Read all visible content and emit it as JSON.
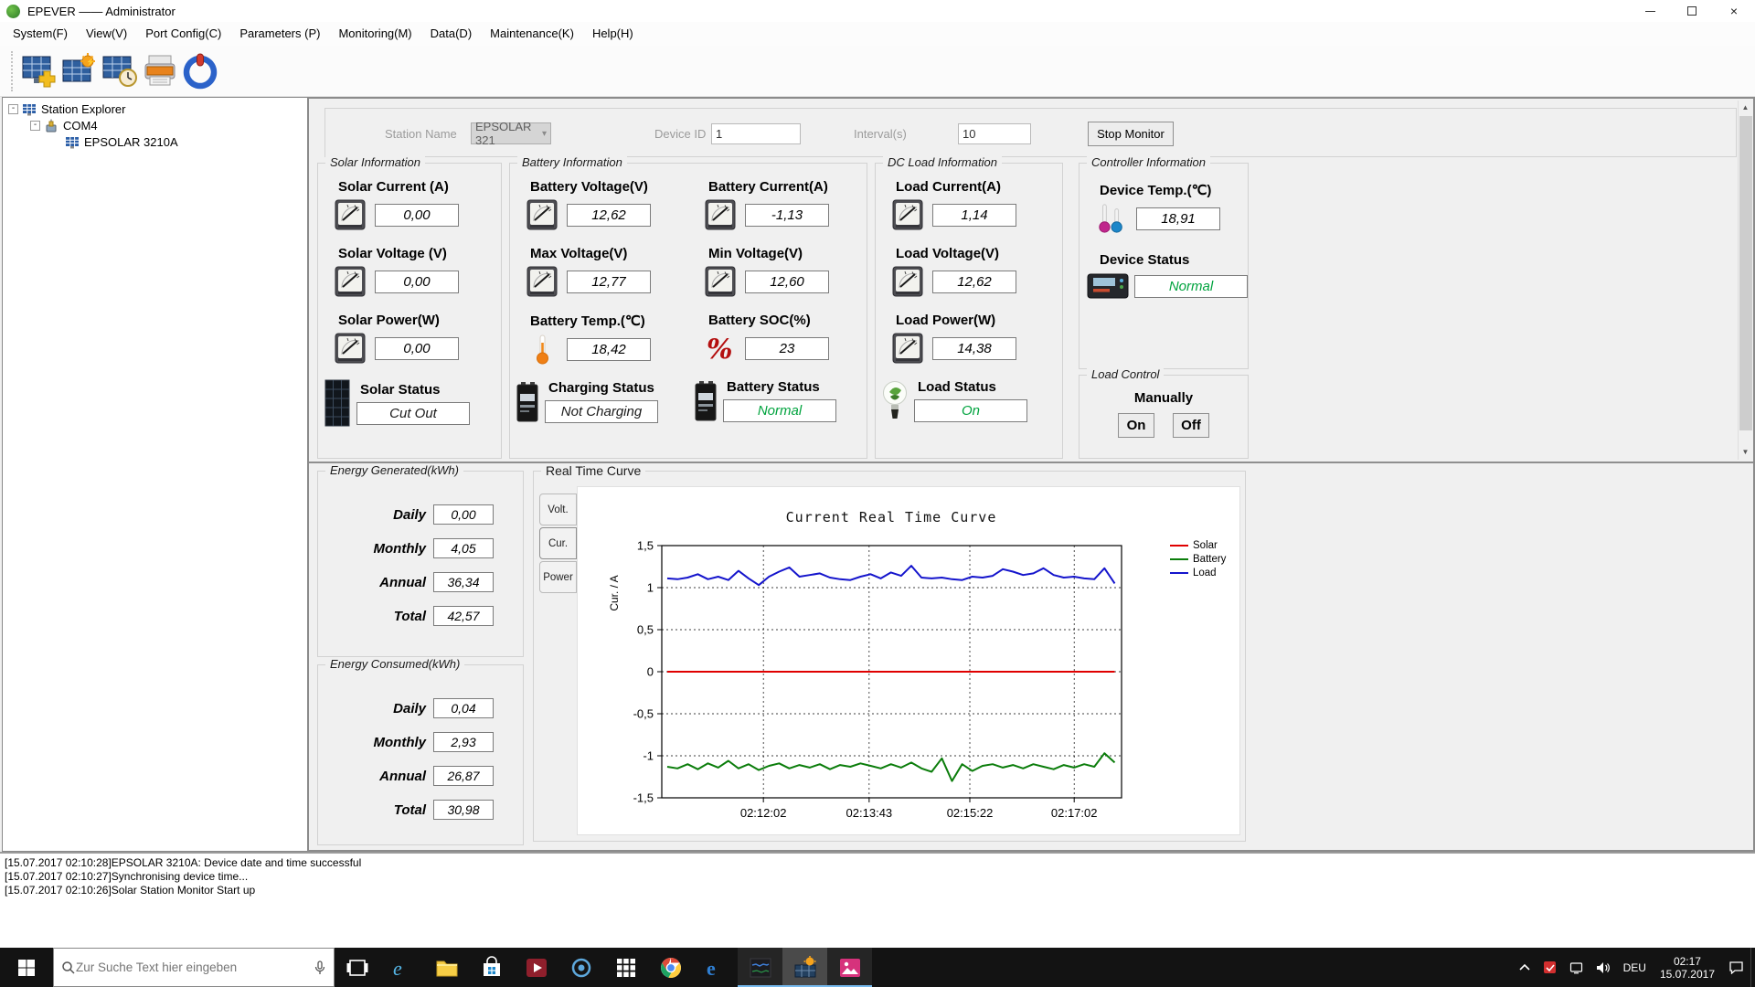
{
  "titlebar": {
    "title": "EPEVER —— Administrator"
  },
  "menu": {
    "items": [
      {
        "label": "System(F)"
      },
      {
        "label": "View(V)"
      },
      {
        "label": "Port Config(C)"
      },
      {
        "label": "Parameters (P)"
      },
      {
        "label": "Monitoring(M)"
      },
      {
        "label": "Data(D)"
      },
      {
        "label": "Maintenance(K)"
      },
      {
        "label": "Help(H)"
      }
    ]
  },
  "toolbar": {
    "buttons": [
      {
        "icon": "new-station-icon"
      },
      {
        "icon": "station-config-icon"
      },
      {
        "icon": "station-time-icon"
      },
      {
        "icon": "print-icon"
      },
      {
        "icon": "power-exit-icon"
      }
    ]
  },
  "tree": {
    "items": [
      {
        "label": "Station Explorer"
      },
      {
        "label": "COM4"
      },
      {
        "label": "EPSOLAR 3210A"
      }
    ]
  },
  "monitor_bar": {
    "station_name_label": "Station Name",
    "station_name_value": "EPSOLAR 321",
    "device_id_label": "Device ID",
    "device_id_value": "1",
    "interval_label": "Interval(s)",
    "interval_value": "10",
    "stop_button_label": "Stop Monitor"
  },
  "sections": {
    "solar": {
      "title": "Solar Information",
      "fields": [
        {
          "label": "Solar Current (A)",
          "value": "0,00"
        },
        {
          "label": "Solar Voltage (V)",
          "value": "0,00"
        },
        {
          "label": "Solar Power(W)",
          "value": "0,00"
        }
      ],
      "status": {
        "label": "Solar Status",
        "value": "Cut Out",
        "color": "#1a1a1a"
      }
    },
    "battery": {
      "title": "Battery Information",
      "col1": [
        {
          "label": "Battery Voltage(V)",
          "value": "12,62"
        },
        {
          "label": "Max Voltage(V)",
          "value": "12,77"
        },
        {
          "label": "Battery Temp.(℃)",
          "value": "18,42"
        }
      ],
      "col2": [
        {
          "label": "Battery Current(A)",
          "value": "-1,13"
        },
        {
          "label": "Min Voltage(V)",
          "value": "12,60"
        },
        {
          "label": "Battery SOC(%)",
          "value": "23"
        }
      ],
      "status1": {
        "label": "Charging Status",
        "value": "Not Charging",
        "color": "#1a1a1a"
      },
      "status2": {
        "label": "Battery Status",
        "value": "Normal",
        "color": "#00a33e"
      }
    },
    "dc_load": {
      "title": "DC Load Information",
      "fields": [
        {
          "label": "Load Current(A)",
          "value": "1,14"
        },
        {
          "label": "Load Voltage(V)",
          "value": "12,62"
        },
        {
          "label": "Load Power(W)",
          "value": "14,38"
        }
      ],
      "status": {
        "label": "Load Status",
        "value": "On",
        "color": "#00a33e"
      }
    },
    "controller": {
      "title": "Controller Information",
      "temp_label": "Device Temp.(℃)",
      "temp_value": "18,91",
      "status_label": "Device Status",
      "status_value": "Normal",
      "status_color": "#00a33e"
    },
    "load_control": {
      "title": "Load Control",
      "manually_label": "Manually",
      "on_label": "On",
      "off_label": "Off"
    }
  },
  "energy_generated": {
    "title": "Energy Generated(kWh)",
    "rows": [
      {
        "label": "Daily",
        "value": "0,00"
      },
      {
        "label": "Monthly",
        "value": "4,05"
      },
      {
        "label": "Annual",
        "value": "36,34"
      },
      {
        "label": "Total",
        "value": "42,57"
      }
    ]
  },
  "energy_consumed": {
    "title": "Energy Consumed(kWh)",
    "rows": [
      {
        "label": "Daily",
        "value": "0,04"
      },
      {
        "label": "Monthly",
        "value": "2,93"
      },
      {
        "label": "Annual",
        "value": "26,87"
      },
      {
        "label": "Total",
        "value": "30,98"
      }
    ]
  },
  "curve_panel": {
    "title": "Real Time Curve",
    "tabs": [
      {
        "label": "Volt."
      },
      {
        "label": "Cur."
      },
      {
        "label": "Power"
      }
    ]
  },
  "chart_data": {
    "type": "line",
    "title": "Current Real Time Curve",
    "ylabel": "Cur. / A",
    "ylim": [
      -1.5,
      1.5
    ],
    "grid": true,
    "legend_position": "right-top",
    "y_ticks": [
      {
        "v": 1.5,
        "label": "1,5"
      },
      {
        "v": 1,
        "label": "1"
      },
      {
        "v": 0.5,
        "label": "0,5"
      },
      {
        "v": 0,
        "label": "0"
      },
      {
        "v": -0.5,
        "label": "-0,5"
      },
      {
        "v": -1,
        "label": "-1"
      },
      {
        "v": -1.5,
        "label": "-1,5"
      }
    ],
    "x_ticks": [
      {
        "f": 0.221,
        "label": "02:12:02"
      },
      {
        "f": 0.451,
        "label": "02:13:43"
      },
      {
        "f": 0.67,
        "label": "02:15:22"
      },
      {
        "f": 0.897,
        "label": "02:17:02"
      }
    ],
    "series": [
      {
        "name": "Solar",
        "color": "#e00000",
        "values": [
          0,
          0,
          0,
          0,
          0,
          0,
          0,
          0,
          0,
          0,
          0,
          0,
          0,
          0,
          0,
          0,
          0,
          0,
          0,
          0,
          0,
          0,
          0,
          0,
          0,
          0,
          0,
          0,
          0,
          0,
          0,
          0,
          0,
          0,
          0,
          0,
          0,
          0,
          0,
          0,
          0,
          0,
          0,
          0,
          0
        ]
      },
      {
        "name": "Battery",
        "color": "#0b7d0b",
        "values": [
          -1.13,
          -1.15,
          -1.1,
          -1.16,
          -1.09,
          -1.14,
          -1.06,
          -1.15,
          -1.1,
          -1.17,
          -1.12,
          -1.09,
          -1.15,
          -1.11,
          -1.14,
          -1.1,
          -1.16,
          -1.11,
          -1.13,
          -1.09,
          -1.12,
          -1.15,
          -1.1,
          -1.14,
          -1.08,
          -1.15,
          -1.19,
          -1.03,
          -1.3,
          -1.1,
          -1.18,
          -1.12,
          -1.1,
          -1.14,
          -1.11,
          -1.15,
          -1.1,
          -1.13,
          -1.16,
          -1.11,
          -1.14,
          -1.1,
          -1.13,
          -0.97,
          -1.08
        ]
      },
      {
        "name": "Load",
        "color": "#1414cc",
        "values": [
          1.11,
          1.1,
          1.12,
          1.16,
          1.1,
          1.13,
          1.09,
          1.2,
          1.11,
          1.03,
          1.13,
          1.19,
          1.24,
          1.13,
          1.15,
          1.17,
          1.12,
          1.1,
          1.09,
          1.13,
          1.16,
          1.11,
          1.18,
          1.14,
          1.26,
          1.12,
          1.11,
          1.12,
          1.1,
          1.09,
          1.13,
          1.12,
          1.14,
          1.22,
          1.19,
          1.15,
          1.17,
          1.23,
          1.15,
          1.12,
          1.13,
          1.11,
          1.1,
          1.23,
          1.05
        ]
      }
    ]
  },
  "log": {
    "lines": [
      "[15.07.2017 02:10:28]EPSOLAR 3210A: Device date and time successful",
      "[15.07.2017 02:10:27]Synchronising device time...",
      "[15.07.2017 02:10:26]Solar Station Monitor Start up"
    ]
  },
  "taskbar": {
    "search_placeholder": "Zur Suche Text hier eingeben",
    "language": "DEU",
    "time": "02:17",
    "date": "15.07.2017"
  }
}
